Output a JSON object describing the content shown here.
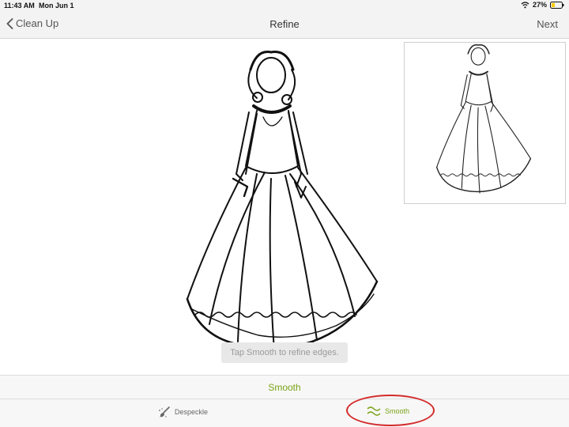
{
  "status_bar": {
    "time": "11:43 AM",
    "date": "Mon Jun 1",
    "battery": "27%",
    "icons": [
      "wifi-icon",
      "battery-icon"
    ]
  },
  "nav": {
    "back_label": "Clean Up",
    "title": "Refine",
    "next_label": "Next"
  },
  "canvas": {
    "hint": "Tap Smooth to refine edges."
  },
  "action_bar": {
    "label": "Smooth"
  },
  "tabs": [
    {
      "label": "Despeckle",
      "icon": "brush-icon",
      "active": false
    },
    {
      "label": "Smooth",
      "icon": "wave-icon",
      "active": true
    }
  ],
  "colors": {
    "accent": "#7aa317",
    "highlight": "#d42a2a",
    "bar_bg": "#f3f3f3"
  }
}
